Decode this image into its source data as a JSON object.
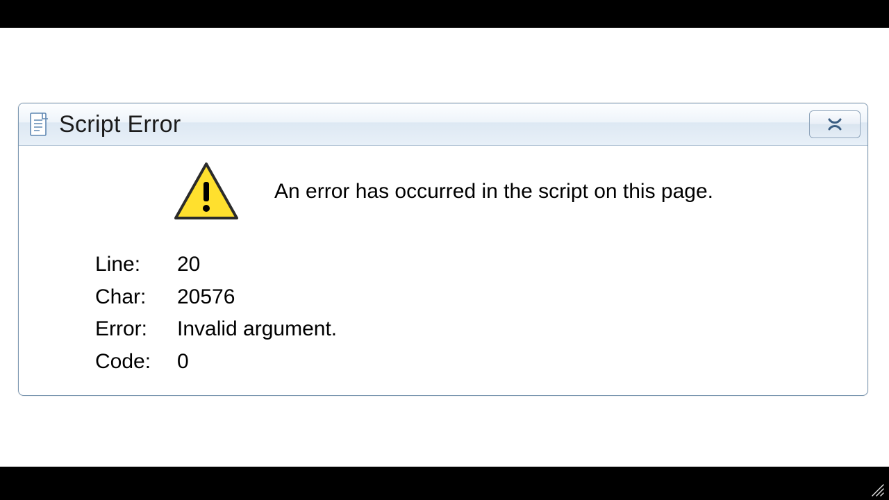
{
  "dialog": {
    "title": "Script Error",
    "message": "An error has occurred in the script on this page.",
    "fields": {
      "line": {
        "label": "Line:",
        "value": "20"
      },
      "char": {
        "label": "Char:",
        "value": "20576"
      },
      "error": {
        "label": "Error:",
        "value": "Invalid argument."
      },
      "code": {
        "label": "Code:",
        "value": "0"
      }
    }
  }
}
